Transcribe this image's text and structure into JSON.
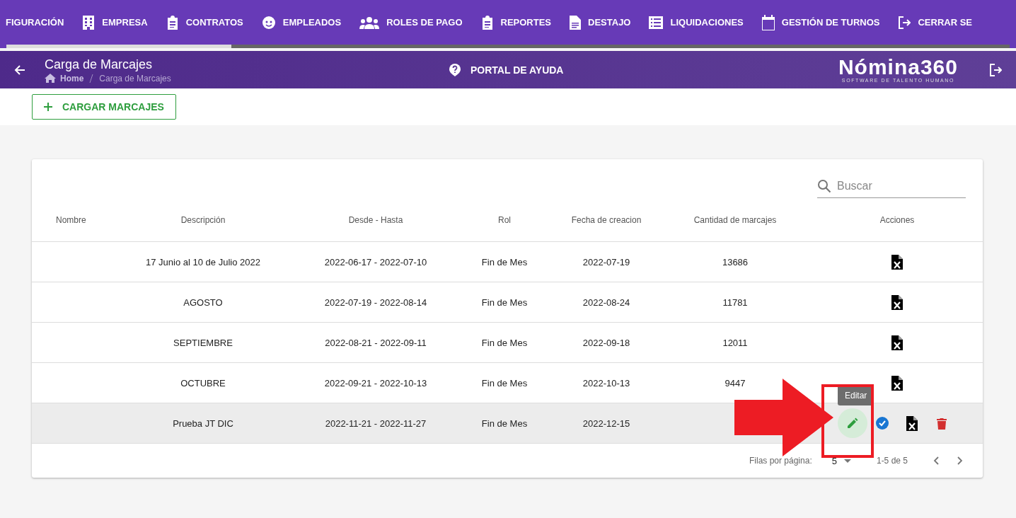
{
  "nav": [
    {
      "label": "FIGURACIÓN"
    },
    {
      "label": "EMPRESA"
    },
    {
      "label": "CONTRATOS"
    },
    {
      "label": "EMPLEADOS"
    },
    {
      "label": "ROLES DE PAGO"
    },
    {
      "label": "REPORTES"
    },
    {
      "label": "DESTAJO"
    },
    {
      "label": "LIQUIDACIONES"
    },
    {
      "label": "GESTIÓN DE TURNOS"
    },
    {
      "label": "CERRAR SE"
    }
  ],
  "header": {
    "title": "Carga de Marcajes",
    "breadcrumb": [
      "Home",
      "Carga de Marcajes"
    ],
    "help": "PORTAL DE AYUDA",
    "logo": "Nómina360",
    "tagline": "SOFTWARE DE TALENTO HUMANO"
  },
  "toolbar": {
    "button": "CARGAR MARCAJES"
  },
  "table": {
    "search": {
      "placeholder": "Buscar"
    },
    "columns": [
      "Nombre",
      "Descripción",
      "Desde - Hasta",
      "Rol",
      "Fecha de creacion",
      "Cantidad de marcajes",
      "Acciones"
    ],
    "rows": [
      {
        "cells": [
          "",
          "17 Junio al 10 de Julio 2022",
          "2022-06-17 - 2022-07-10",
          "Fin de Mes",
          "2022-07-19",
          "13686"
        ],
        "hovered": false,
        "actions": [
          {
            "kind": "excel"
          }
        ]
      },
      {
        "cells": [
          "",
          "AGOSTO",
          "2022-07-19 - 2022-08-14",
          "Fin de Mes",
          "2022-08-24",
          "11781"
        ],
        "hovered": false,
        "actions": [
          {
            "kind": "excel"
          }
        ]
      },
      {
        "cells": [
          "",
          "SEPTIEMBRE",
          "2022-08-21 - 2022-09-11",
          "Fin de Mes",
          "2022-09-18",
          "12011"
        ],
        "hovered": false,
        "actions": [
          {
            "kind": "excel"
          }
        ]
      },
      {
        "cells": [
          "",
          "OCTUBRE",
          "2022-09-21 - 2022-10-13",
          "Fin de Mes",
          "2022-10-13",
          "9447"
        ],
        "hovered": false,
        "actions": [
          {
            "kind": "excel"
          }
        ]
      },
      {
        "cells": [
          "",
          "Prueba JT DIC",
          "2022-11-21 - 2022-11-27",
          "Fin de Mes",
          "2022-12-15"
        ],
        "hovered": true,
        "actions": [
          {
            "kind": "edit"
          },
          {
            "kind": "approve"
          },
          {
            "kind": "excel"
          },
          {
            "kind": "delete"
          }
        ]
      }
    ],
    "tooltip": "Editar",
    "footer": {
      "rows_label": "Filas por página:",
      "rows_value": "5",
      "range": "1-5 de 5"
    }
  }
}
